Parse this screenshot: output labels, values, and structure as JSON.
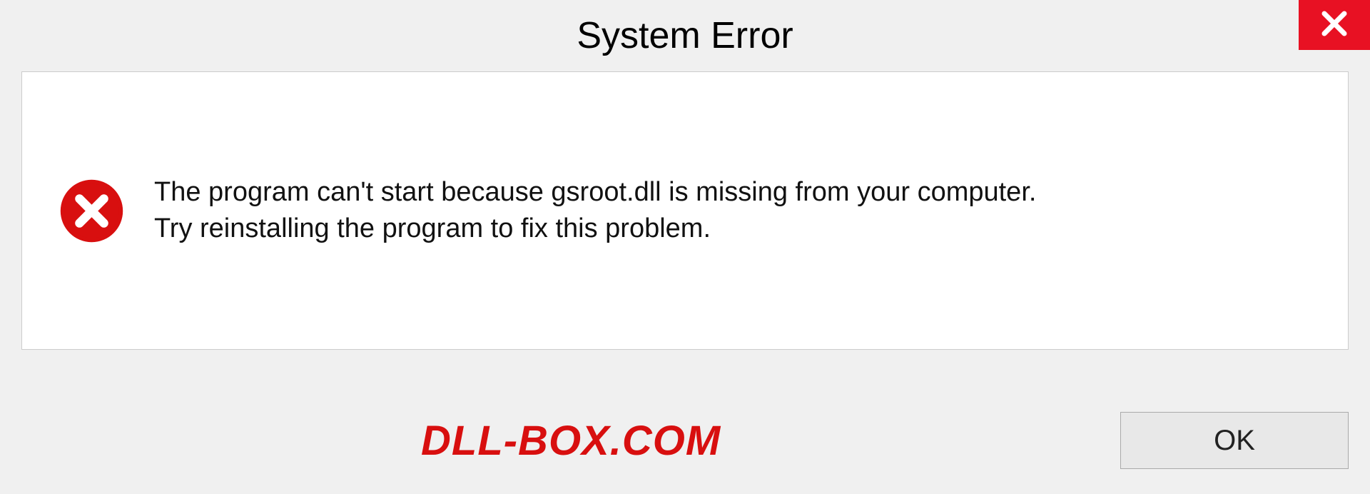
{
  "dialog": {
    "title": "System Error",
    "message_line1": "The program can't start because gsroot.dll is missing from your computer.",
    "message_line2": "Try reinstalling the program to fix this problem.",
    "ok_label": "OK"
  },
  "watermark": "DLL-BOX.COM",
  "colors": {
    "close_bg": "#e81123",
    "error_icon": "#d80f0f",
    "watermark": "#d80f0f"
  }
}
